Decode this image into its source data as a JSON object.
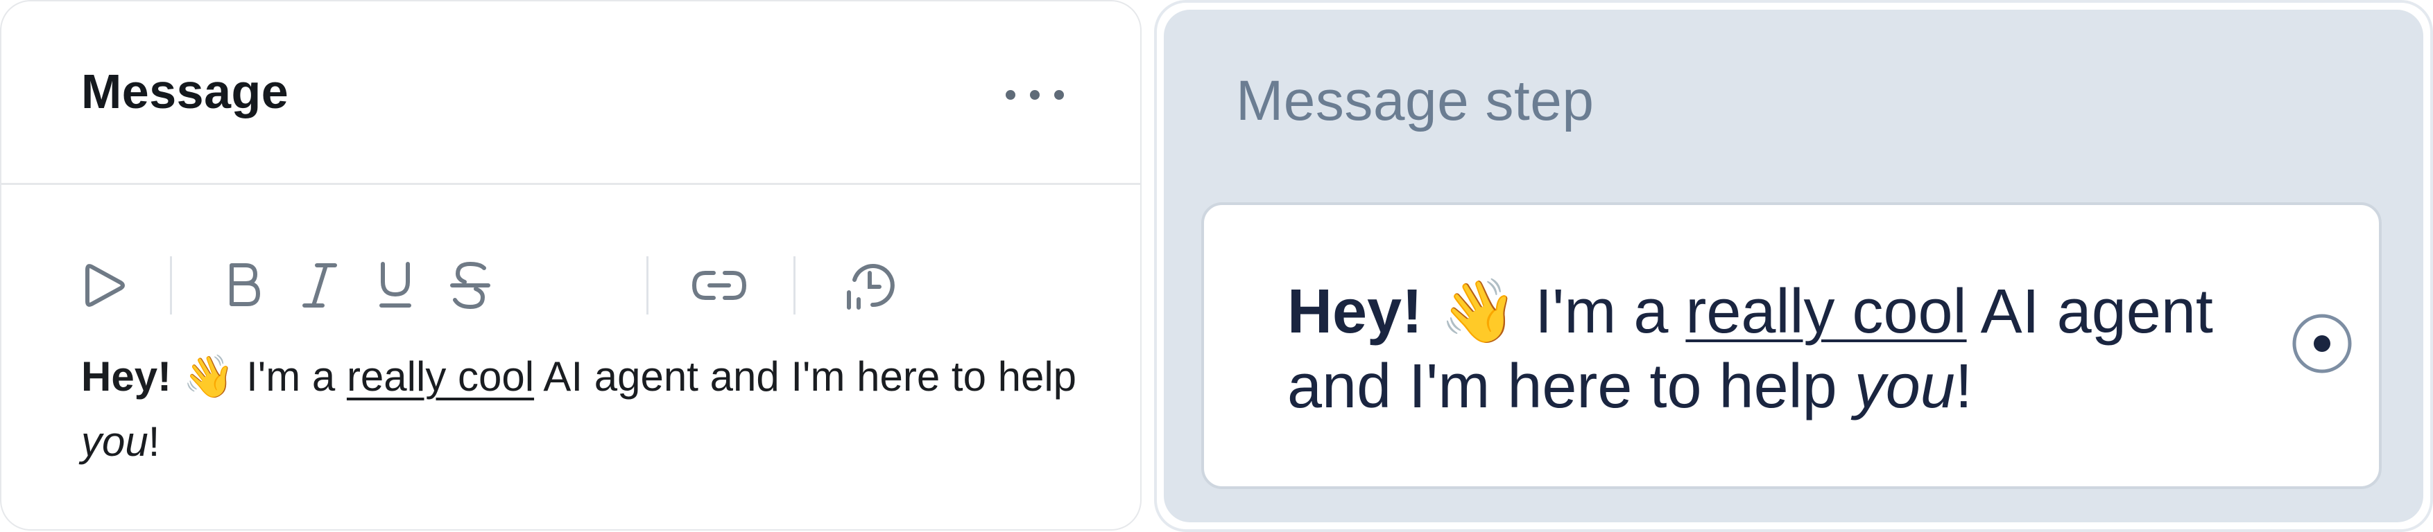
{
  "left_panel": {
    "title": "Message",
    "toolbar": {
      "buttons": [
        "play-icon",
        "bold-icon",
        "italic-icon",
        "underline-icon",
        "strikethrough-icon",
        "link-icon",
        "clock-icon"
      ]
    },
    "content": {
      "greeting": "Hey!",
      "emoji": "👋",
      "text_before": " I'm a ",
      "underlined": "really cool",
      "text_middle": " AI agent and I'm here to help ",
      "italic": "you",
      "text_end": "!"
    }
  },
  "right_panel": {
    "label": "Message step",
    "card": {
      "greeting": "Hey!",
      "emoji": "👋",
      "text_before": " I'm a ",
      "underlined": "really cool",
      "text_middle": " AI agent and I'm here to help ",
      "italic": "you",
      "text_end": "!"
    }
  },
  "colors": {
    "text_primary": "#15191e",
    "card_text": "#1a2540",
    "muted_icon": "#6f7a86",
    "step_panel_bg": "#dde4ec",
    "step_label": "#6b7d92"
  }
}
